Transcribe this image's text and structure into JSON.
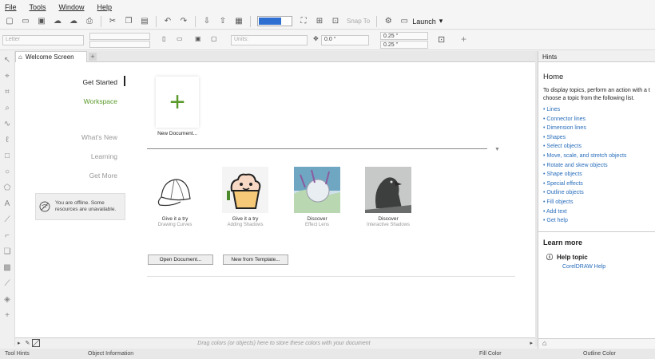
{
  "menu": [
    "File",
    "Tools",
    "Window",
    "Help"
  ],
  "toolbar": {
    "snap_label": "Snap To",
    "launch_label": "Launch",
    "zoom_color": "#2f6fd1"
  },
  "property_bar": {
    "paper": "Letter",
    "units": "Units:",
    "rotation": "0.0 °",
    "nudge_x": "0.25 \"",
    "nudge_y": "0.25 \""
  },
  "tab": {
    "label": "Welcome Screen",
    "add": "+"
  },
  "nav": {
    "items": [
      {
        "label": "Get Started",
        "state": "active"
      },
      {
        "label": "Workspace",
        "state": "green"
      },
      {
        "label": "What's New",
        "state": ""
      },
      {
        "label": "Learning",
        "state": ""
      },
      {
        "label": "Get More",
        "state": ""
      }
    ],
    "offline_message": "You are offline. Some resources are unavailable."
  },
  "new_document": {
    "label": "New Document..."
  },
  "cards": [
    {
      "title": "Give it a try",
      "subtitle": "Drawing Curves"
    },
    {
      "title": "Give it a try",
      "subtitle": "Adding Shadows"
    },
    {
      "title": "Discover",
      "subtitle": "Effect Lens"
    },
    {
      "title": "Discover",
      "subtitle": "Interactive Shadows"
    }
  ],
  "buttons": {
    "open": "Open Document...",
    "template": "New from Template..."
  },
  "hints": {
    "panel_title": "Hints",
    "heading": "Home",
    "intro_line1": "To display topics, perform an action with a t",
    "intro_line2": "choose a topic from the following list.",
    "topics": [
      "Lines",
      "Connector lines",
      "Dimension lines",
      "Shapes",
      "Select objects",
      "Move, scale, and stretch objects",
      "Rotate and skew objects",
      "Shape objects",
      "Special effects",
      "Outline objects",
      "Fill objects",
      "Add text",
      "Get help"
    ],
    "learn_more": "Learn more",
    "help_topic": "Help topic",
    "help_link": "CorelDRAW Help"
  },
  "palette": {
    "hint": "Drag colors (or objects) here to store these colors with your document"
  },
  "status": {
    "tool_hints": "Tool Hints",
    "object_info": "Object Information",
    "fill_color": "Fill Color",
    "outline_color": "Outline Color"
  }
}
